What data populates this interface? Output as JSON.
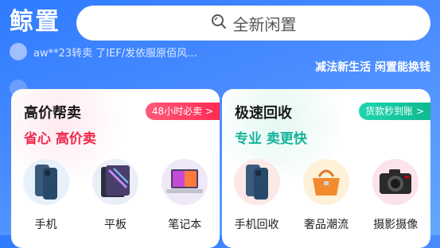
{
  "header": {
    "logo": "鲸置",
    "search_placeholder": "全新闲置",
    "ticker_1": "aw**23转卖 了IEF/发依服原佰风...",
    "ticker_2": "...",
    "slogan": "减法新生活 闲置能换钱"
  },
  "left_card": {
    "title": "高价帮卖",
    "subtitle": "省心 高价卖",
    "badge": "48小时必卖 >",
    "items": [
      {
        "label": "手机",
        "icon": "phone-icon"
      },
      {
        "label": "平板",
        "icon": "tablet-icon"
      },
      {
        "label": "笔记本",
        "icon": "laptop-icon"
      }
    ]
  },
  "right_card": {
    "title": "极速回收",
    "subtitle": "专业 卖更快",
    "badge": "货款秒到账 >",
    "items": [
      {
        "label": "手机回收",
        "icon": "phone-icon"
      },
      {
        "label": "奢品潮流",
        "icon": "handbag-icon"
      },
      {
        "label": "摄影摄像",
        "icon": "camera-icon"
      }
    ]
  },
  "colors": {
    "brand_blue": "#3a86ff",
    "accent_red": "#f0284a",
    "accent_green": "#15b39a"
  }
}
